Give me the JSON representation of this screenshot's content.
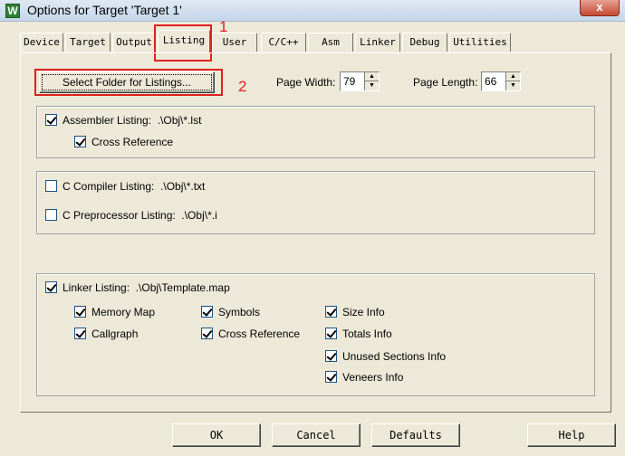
{
  "window": {
    "title": "Options for Target 'Target 1'",
    "app_icon_letter": "W",
    "close_label": "x"
  },
  "tabs": [
    {
      "label": "Device"
    },
    {
      "label": "Target"
    },
    {
      "label": "Output"
    },
    {
      "label": "Listing",
      "active": true
    },
    {
      "label": "User"
    },
    {
      "label": "C/C++"
    },
    {
      "label": "Asm"
    },
    {
      "label": "Linker"
    },
    {
      "label": "Debug"
    },
    {
      "label": "Utilities"
    }
  ],
  "annotations": {
    "one": "1",
    "two": "2"
  },
  "listing": {
    "select_folder_label": "Select Folder for Listings...",
    "page_width_label": "Page Width:",
    "page_width_value": "79",
    "page_length_label": "Page Length:",
    "page_length_value": "66",
    "assembler_listing": {
      "label": "Assembler Listing:",
      "path": ".\\Obj\\*.lst",
      "checked": true
    },
    "cross_reference": {
      "label": "Cross Reference",
      "checked": true
    },
    "c_compiler_listing": {
      "label": "C Compiler Listing:",
      "path": ".\\Obj\\*.txt",
      "checked": false
    },
    "c_preprocessor_listing": {
      "label": "C Preprocessor Listing:",
      "path": ".\\Obj\\*.i",
      "checked": false
    },
    "linker_listing": {
      "label": "Linker Listing:",
      "path": ".\\Obj\\Template.map",
      "checked": true
    },
    "linker_options": {
      "memory_map": "Memory Map",
      "callgraph": "Callgraph",
      "symbols": "Symbols",
      "cross_reference": "Cross Reference",
      "size_info": "Size Info",
      "totals_info": "Totals Info",
      "unused_sections_info": "Unused Sections Info",
      "veneers_info": "Veneers Info"
    }
  },
  "footer": {
    "ok": "OK",
    "cancel": "Cancel",
    "defaults": "Defaults",
    "help": "Help"
  }
}
